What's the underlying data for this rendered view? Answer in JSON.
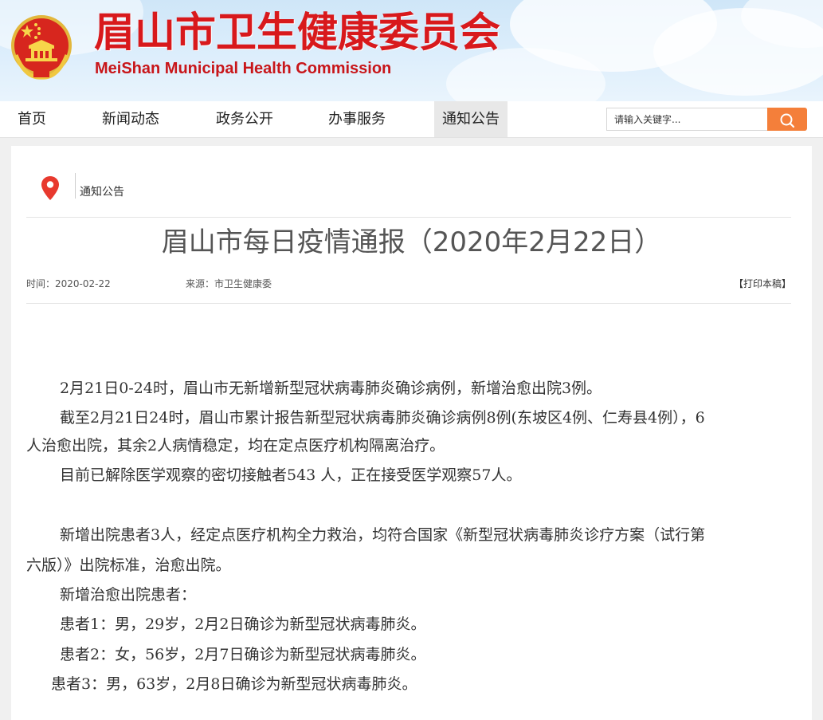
{
  "site": {
    "title_cn": "眉山市卫生健康委员会",
    "title_en": "MeiShan Municipal Health Commission",
    "colors": {
      "brand_red": "#d8191c",
      "search_orange": "#f47f3a",
      "nav_active_bg": "#e8e8e8"
    }
  },
  "nav": {
    "items": [
      {
        "label": "首页"
      },
      {
        "label": "新闻动态"
      },
      {
        "label": "政务公开"
      },
      {
        "label": "办事服务"
      },
      {
        "label": "通知公告",
        "active": true
      }
    ]
  },
  "search": {
    "placeholder": "请输入关键字...",
    "button_icon": "search-icon"
  },
  "breadcrumb": {
    "icon": "location-pin-icon",
    "label": "通知公告"
  },
  "article": {
    "title": "眉山市每日疫情通报（2020年2月22日）",
    "time": "时间：2020-02-22",
    "source": "来源：市卫生健康委",
    "print": "【打印本稿】",
    "lines": [
      "2月21日0-24时，眉山市无新增新型冠状病毒肺炎确诊病例，新增治愈出院3例。",
      "截至2月21日24时，眉山市累计报告新型冠状病毒肺炎确诊病例8例(东坡区4例、仁寿县4例），6",
      "人治愈出院，其余2人病情稳定，均在定点医疗机构隔离治疗。",
      "目前已解除医学观察的密切接触者543 人，正在接受医学观察57人。",
      "新增出院患者3人，经定点医疗机构全力救治，均符合国家《新型冠状病毒肺炎诊疗方案（试行第",
      "六版）》出院标准，治愈出院。",
      "新增治愈出院患者：",
      "患者1：男，29岁，2月2日确诊为新型冠状病毒肺炎。",
      "患者2：女，56岁，2月7日确诊为新型冠状病毒肺炎。",
      "患者3：男，63岁，2月8日确诊为新型冠状病毒肺炎。"
    ]
  }
}
